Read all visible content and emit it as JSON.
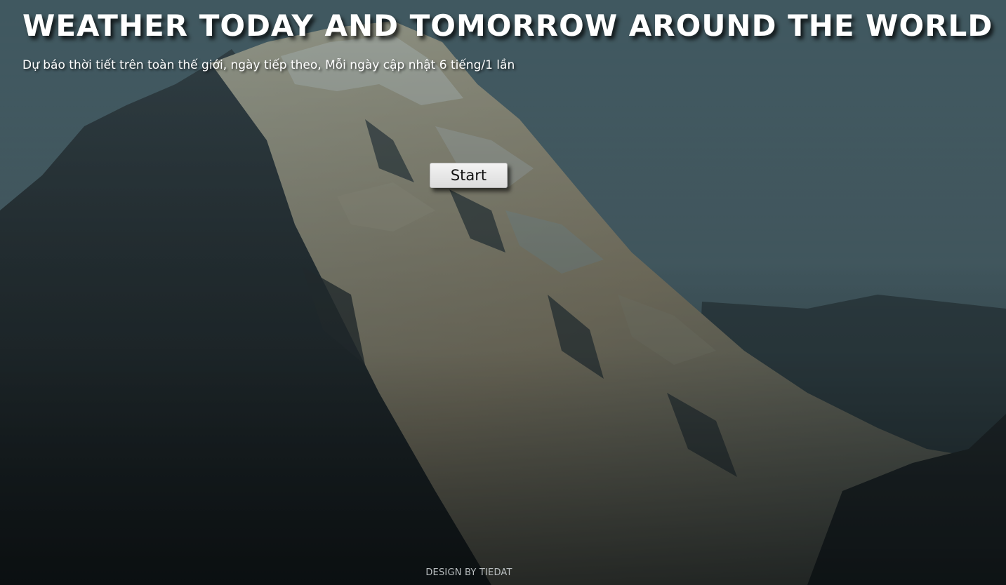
{
  "header": {
    "title": "WEATHER TODAY AND TOMORROW AROUND THE WORLD",
    "subtitle": "Dự báo thời tiết trên toàn thế giới, ngày tiếp theo, Mỗi ngày cập nhật 6 tiếng/1 lần"
  },
  "main": {
    "start_label": "Start"
  },
  "footer": {
    "credit": "DESIGN BY TIEDAT"
  },
  "background": {
    "image": "mountain-painting",
    "sky_color": "#5f7e87",
    "snow_color": "#a8a48e",
    "rock_color": "#2c3437"
  }
}
